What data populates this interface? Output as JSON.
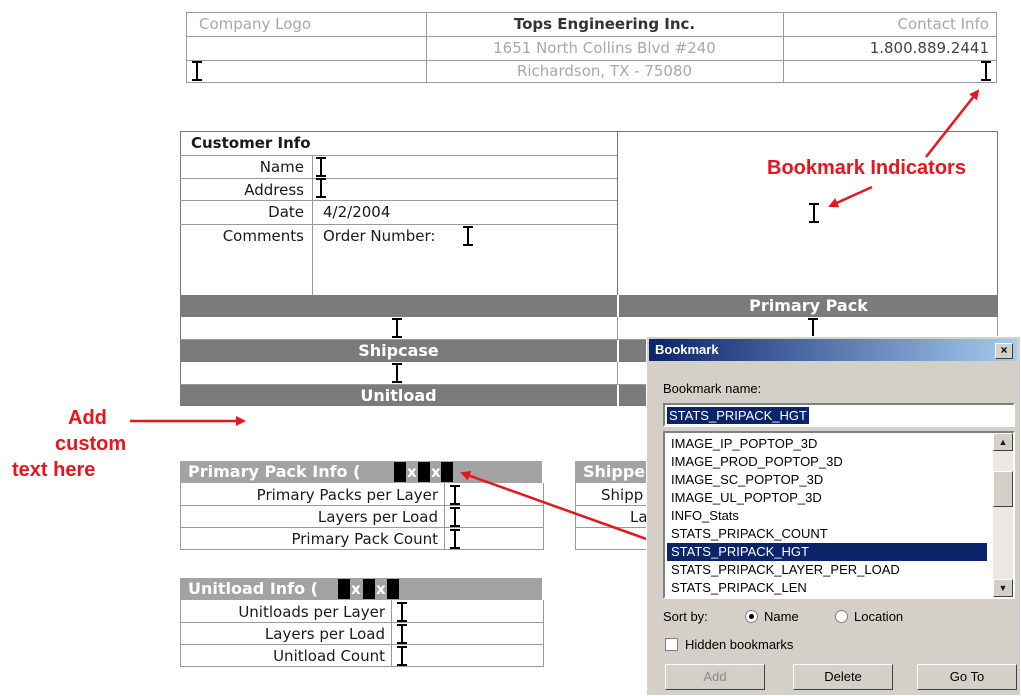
{
  "header": {
    "logo": "Company Logo",
    "company": "Tops Engineering Inc.",
    "contact": "Contact Info",
    "address1": "1651 North Collins Blvd #240",
    "phone": "1.800.889.2441",
    "address2": "Richardson, TX - 75080"
  },
  "customer": {
    "title": "Customer Info",
    "name_label": "Name",
    "address_label": "Address",
    "date_label": "Date",
    "date_value": "4/2/2004",
    "comments_label": "Comments",
    "comments_value": "Order Number:"
  },
  "sections": {
    "primary_pack": "Primary Pack",
    "shipcase": "Shipcase",
    "unitload": "Unitload"
  },
  "primary_pack_info": {
    "title": "Primary Pack Info (",
    "rows": [
      "Primary Packs per Layer",
      "Layers per Load",
      "Primary Pack Count"
    ]
  },
  "shipper_info": {
    "title": "Shippe",
    "rows": [
      "Shipp",
      "La"
    ]
  },
  "unitload_info": {
    "title": "Unitload Info (",
    "rows": [
      "Unitloads per Layer",
      "Layers per Load",
      "Unitload Count"
    ]
  },
  "annotations": {
    "bookmark_indicators": "Bookmark Indicators",
    "add_custom": [
      "Add",
      "custom",
      "text here"
    ],
    "color": "#e8141e"
  },
  "dialog": {
    "title": "Bookmark",
    "close": "×",
    "name_label": "Bookmark name:",
    "name_value": "STATS_PRIPACK_HGT",
    "items": [
      "IMAGE_IP_POPTOP_3D",
      "IMAGE_PROD_POPTOP_3D",
      "IMAGE_SC_POPTOP_3D",
      "IMAGE_UL_POPTOP_3D",
      "INFO_Stats",
      "STATS_PRIPACK_COUNT",
      "STATS_PRIPACK_HGT",
      "STATS_PRIPACK_LAYER_PER_LOAD",
      "STATS_PRIPACK_LEN"
    ],
    "selected_index": 6,
    "sort_label": "Sort by:",
    "sort_name": "Name",
    "sort_location": "Location",
    "hidden_label": "Hidden bookmarks",
    "add": "Add",
    "delete": "Delete",
    "goto": "Go To"
  }
}
